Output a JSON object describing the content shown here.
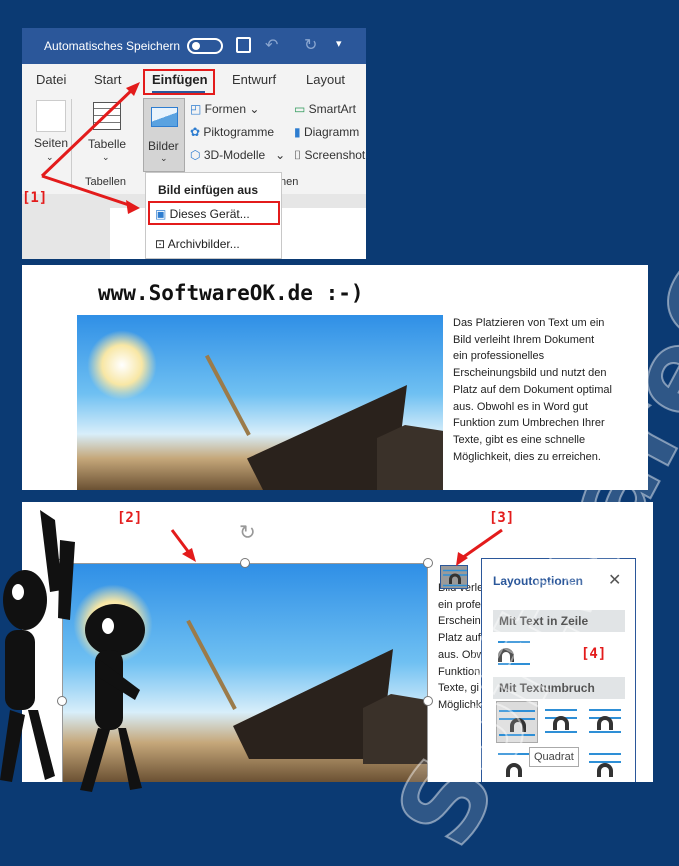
{
  "word": {
    "autosave_label": "Automatisches Speichern",
    "tabs": [
      "Datei",
      "Start",
      "Einfügen",
      "Entwurf",
      "Layout"
    ],
    "active_tab": "Einfügen",
    "ribbon": {
      "seiten": "Seiten",
      "tabelle": "Tabelle",
      "tabellen_group": "Tabellen",
      "bilder": "Bilder",
      "formen": "Formen",
      "piktogramme": "Piktogramme",
      "modelle": "3D-Modelle",
      "smartart": "SmartArt",
      "diagramm": "Diagramm",
      "screenshot": "Screenshot",
      "group_suffix": "nen"
    },
    "menu": {
      "header": "Bild einfügen aus",
      "items": [
        "Dieses Gerät...",
        "Archivbilder..."
      ]
    }
  },
  "annotations": {
    "step1": "[1]",
    "step2": "[2]",
    "step3": "[3]",
    "step4": "[4]"
  },
  "watermark": "www.SoftwareOK.de :-)",
  "body_text_lines": [
    "Das Platzieren von Text um ein",
    "Bild verleiht Ihrem Dokument",
    "ein professionelles",
    "Erscheinungsbild und nutzt den",
    "Platz auf dem Dokument optimal",
    "aus. Obwohl es in Word gut",
    "Funktion zum Umbrechen Ihrer",
    "Texte, gibt es eine schnelle",
    "Möglichkeit, dies zu erreichen."
  ],
  "body_text_cut": [
    "Bild verle",
    "ein profe",
    "Erschein",
    "Platz auf",
    "aus. Obw",
    "Funktion",
    "Texte, gi",
    "Möglichk"
  ],
  "layout_options": {
    "title": "Layoutoptionen",
    "section_inline": "Mit Text in Zeile",
    "section_wrap": "Mit Textumbruch",
    "tooltip": "Quadrat"
  },
  "colors": {
    "background": "#0b3a73",
    "word_blue": "#2b579a",
    "highlight_red": "#e31b1b"
  }
}
